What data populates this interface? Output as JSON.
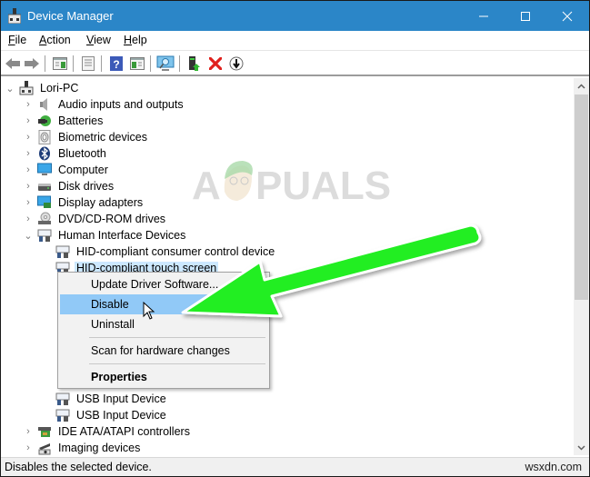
{
  "window": {
    "title": "Device Manager",
    "controls": {
      "minimize": "minimize",
      "maximize": "maximize",
      "close": "close"
    }
  },
  "menubar": {
    "items": [
      {
        "label": "File",
        "accel": "F",
        "rest": "ile"
      },
      {
        "label": "Action",
        "accel": "A",
        "rest": "ction"
      },
      {
        "label": "View",
        "accel": "V",
        "rest": "iew"
      },
      {
        "label": "Help",
        "accel": "H",
        "rest": "elp"
      }
    ]
  },
  "toolbar": {
    "buttons": [
      {
        "name": "back",
        "icon": "arrow-left-icon"
      },
      {
        "name": "forward",
        "icon": "arrow-right-icon"
      },
      {
        "name": "show-hide-console-tree",
        "icon": "console-tree-icon"
      },
      {
        "name": "properties",
        "icon": "properties-icon"
      },
      {
        "name": "help",
        "icon": "help-icon"
      },
      {
        "name": "show-action-pane",
        "icon": "action-pane-icon"
      },
      {
        "name": "scan-hardware",
        "icon": "scan-monitor-icon"
      },
      {
        "name": "update-driver",
        "icon": "update-driver-icon"
      },
      {
        "name": "uninstall",
        "icon": "red-x-icon"
      },
      {
        "name": "disable",
        "icon": "down-arrow-circle-icon"
      }
    ]
  },
  "tree": {
    "root": {
      "label": "Lori-PC",
      "expanded": true
    },
    "items": [
      {
        "label": "Audio inputs and outputs",
        "icon": "speaker-icon",
        "level": 1,
        "expanded": false
      },
      {
        "label": "Batteries",
        "icon": "battery-icon",
        "level": 1,
        "expanded": false
      },
      {
        "label": "Biometric devices",
        "icon": "fingerprint-icon",
        "level": 1,
        "expanded": false
      },
      {
        "label": "Bluetooth",
        "icon": "bluetooth-icon",
        "level": 1,
        "expanded": false
      },
      {
        "label": "Computer",
        "icon": "monitor-icon",
        "level": 1,
        "expanded": false
      },
      {
        "label": "Disk drives",
        "icon": "disk-drive-icon",
        "level": 1,
        "expanded": false
      },
      {
        "label": "Display adapters",
        "icon": "display-adapter-icon",
        "level": 1,
        "expanded": false
      },
      {
        "label": "DVD/CD-ROM drives",
        "icon": "dvd-drive-icon",
        "level": 1,
        "expanded": false
      },
      {
        "label": "Human Interface Devices",
        "icon": "hid-icon",
        "level": 1,
        "expanded": true
      },
      {
        "label": "HID-compliant consumer control device",
        "icon": "hid-icon",
        "level": 2
      },
      {
        "label": "HID-compliant touch screen",
        "icon": "hid-icon",
        "level": 2,
        "selected": true
      },
      {
        "label": "USB Input Device",
        "icon": "hid-icon",
        "level": 2
      },
      {
        "label": "USB Input Device",
        "icon": "hid-icon",
        "level": 2
      },
      {
        "label": "IDE ATA/ATAPI controllers",
        "icon": "ide-controller-icon",
        "level": 1,
        "expanded": false
      },
      {
        "label": "Imaging devices",
        "icon": "camera-icon",
        "level": 1,
        "expanded": false
      }
    ]
  },
  "context_menu": {
    "items": [
      {
        "label": "Update Driver Software...",
        "hover": false,
        "bold": false
      },
      {
        "label": "Disable",
        "hover": true,
        "bold": false
      },
      {
        "label": "Uninstall",
        "hover": false,
        "bold": false
      },
      {
        "label": "Scan for hardware changes",
        "hover": false,
        "bold": false
      },
      {
        "label": "Properties",
        "hover": false,
        "bold": true
      }
    ]
  },
  "statusbar": {
    "text": "Disables the selected device.",
    "site_watermark": "wsxdn.com"
  },
  "overlay": {
    "watermark_text": "PUALS",
    "watermark_prefix": "A",
    "arrow_color": "#22ee22"
  }
}
